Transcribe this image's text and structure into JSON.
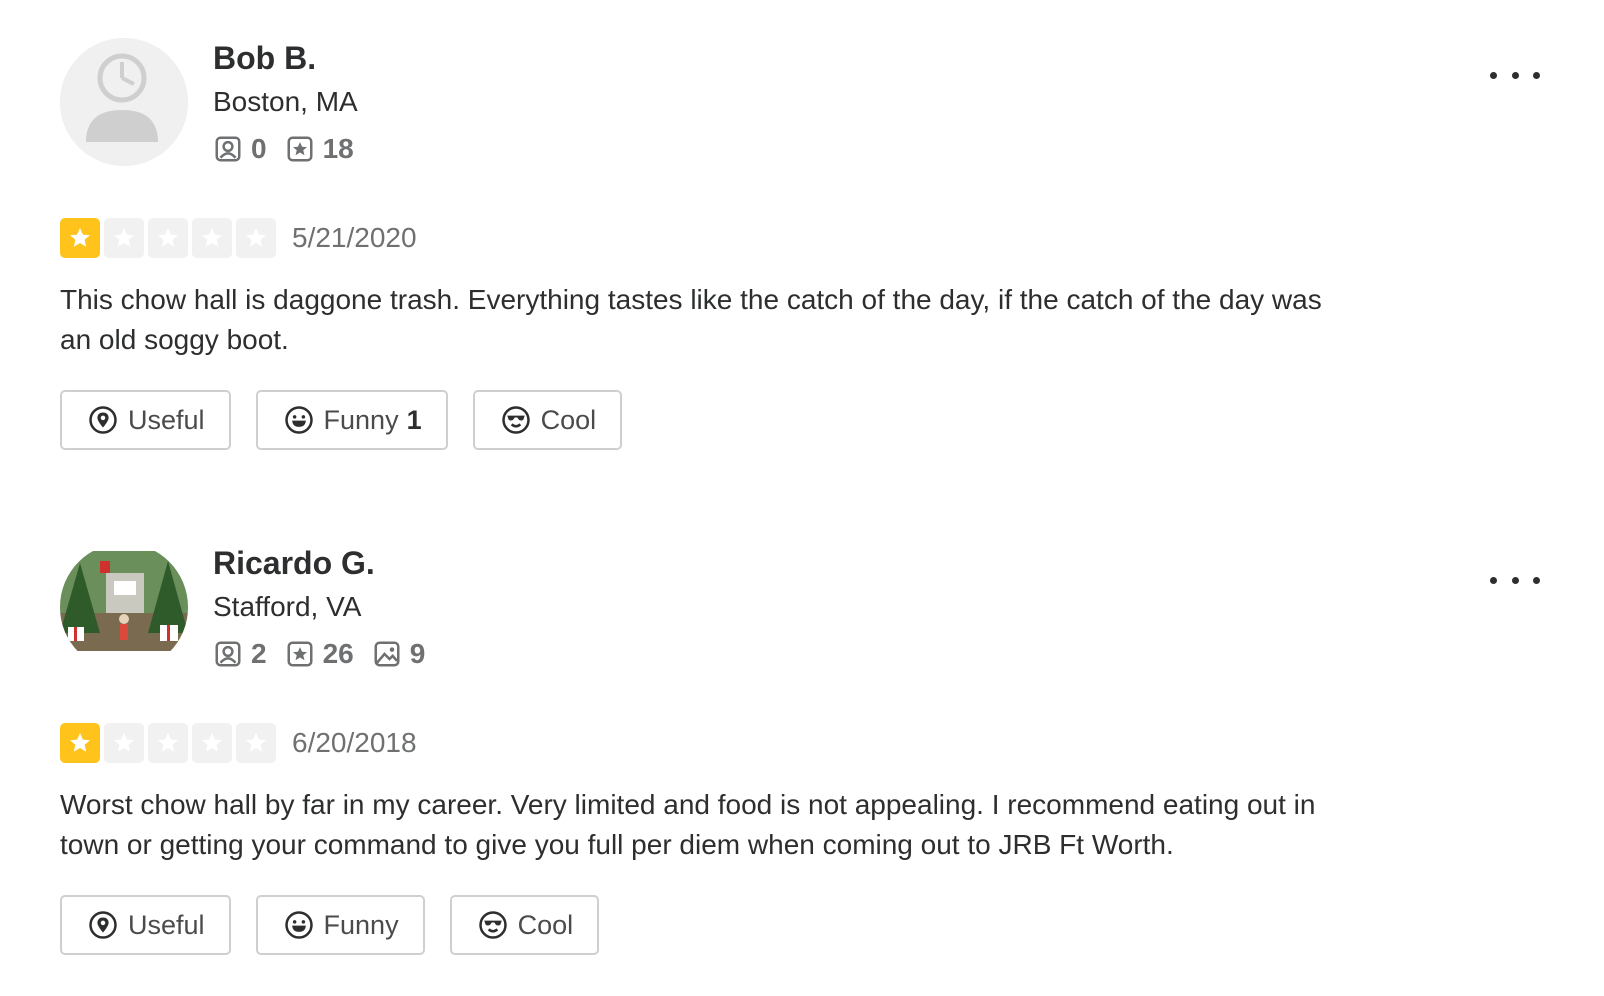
{
  "reviews": [
    {
      "user": {
        "name": "Bob B.",
        "location": "Boston, MA",
        "friends": "0",
        "reviews": "18"
      },
      "rating": 1,
      "date": "5/21/2020",
      "text": "This chow hall is daggone trash. Everything tastes like the catch of the day, if the catch of the day was an old soggy boot.",
      "actions": {
        "useful_label": "Useful",
        "funny_label": "Funny",
        "funny_count": "1",
        "cool_label": "Cool"
      }
    },
    {
      "user": {
        "name": "Ricardo G.",
        "location": "Stafford, VA",
        "friends": "2",
        "reviews": "26",
        "photos": "9"
      },
      "rating": 1,
      "date": "6/20/2018",
      "text": "Worst chow hall by far in my career. Very limited and food is not appealing. I recommend eating out in town or getting your command to give you full per diem when coming out to JRB Ft Worth.",
      "actions": {
        "useful_label": "Useful",
        "funny_label": "Funny",
        "cool_label": "Cool"
      }
    }
  ],
  "colors": {
    "star_filled": "#ffc31c",
    "star_empty": "#f1f1f1",
    "text": "#2d2e2f",
    "muted": "#6e7072"
  },
  "icons": [
    "friends-icon",
    "reviews-star-icon",
    "photos-icon",
    "useful-icon",
    "funny-icon",
    "cool-icon",
    "more-options-icon",
    "star-icon"
  ]
}
